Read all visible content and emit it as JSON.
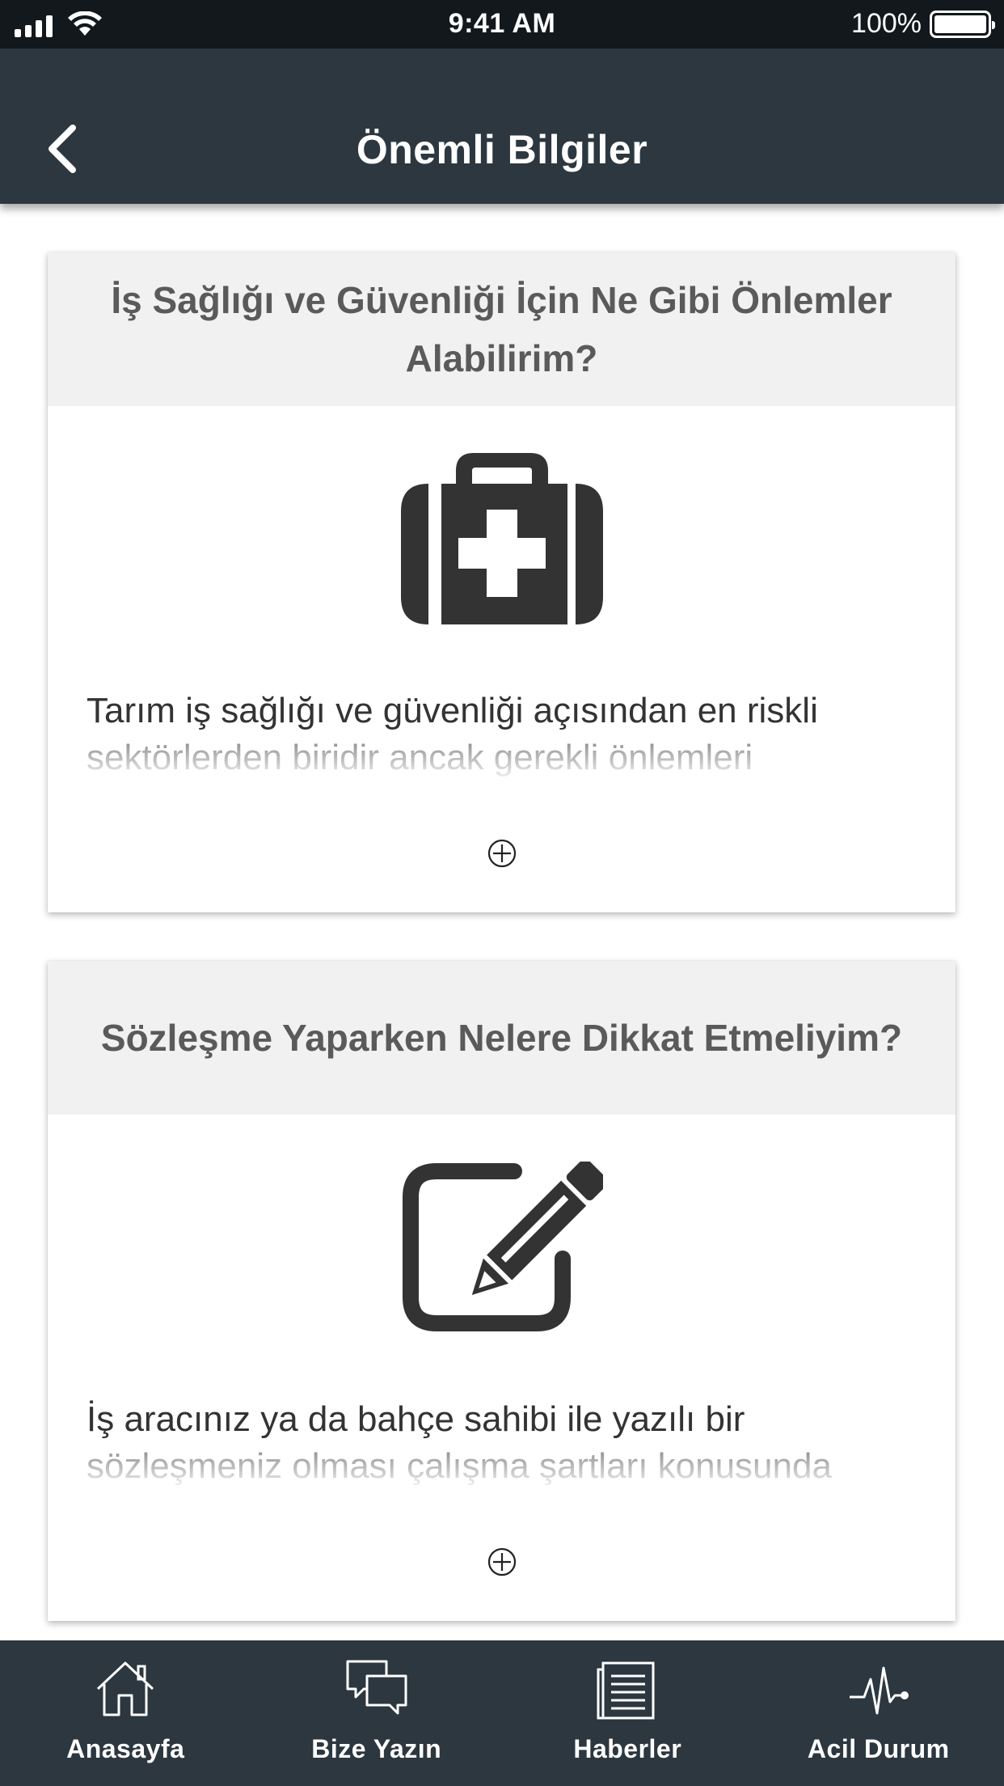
{
  "status_bar": {
    "time": "9:41 AM",
    "battery": "100%"
  },
  "header": {
    "title": "Önemli Bilgiler",
    "back_icon": "chevron-left-icon"
  },
  "cards": [
    {
      "title": "İş Sağlığı ve Güvenliği İçin Ne Gibi Önlemler Alabilirim?",
      "icon": "first-aid-kit-icon",
      "text": "Tarım iş sağlığı ve güvenliği açısından en riskli sektörlerden biridir ancak gerekli önlemleri",
      "expand_icon": "plus-circle-icon"
    },
    {
      "title": "Sözleşme Yaparken Nelere Dikkat Etmeliyim?",
      "icon": "edit-pencil-icon",
      "text": "İş aracınız ya da bahçe sahibi ile yazılı bir sözleşmeniz olması çalışma şartları konusunda",
      "expand_icon": "plus-circle-icon"
    }
  ],
  "tab_bar": {
    "items": [
      {
        "label": "Anasayfa",
        "icon": "home-icon"
      },
      {
        "label": "Bize Yazın",
        "icon": "chat-bubbles-icon"
      },
      {
        "label": "Haberler",
        "icon": "news-icon"
      },
      {
        "label": "Acil Durum",
        "icon": "pulse-icon"
      }
    ]
  },
  "colors": {
    "header_bg": "#2c3740",
    "status_bg": "#12181c",
    "card_header_bg": "#f1f1f1",
    "icon_color": "#333333",
    "title_color": "#5a5a5a"
  }
}
